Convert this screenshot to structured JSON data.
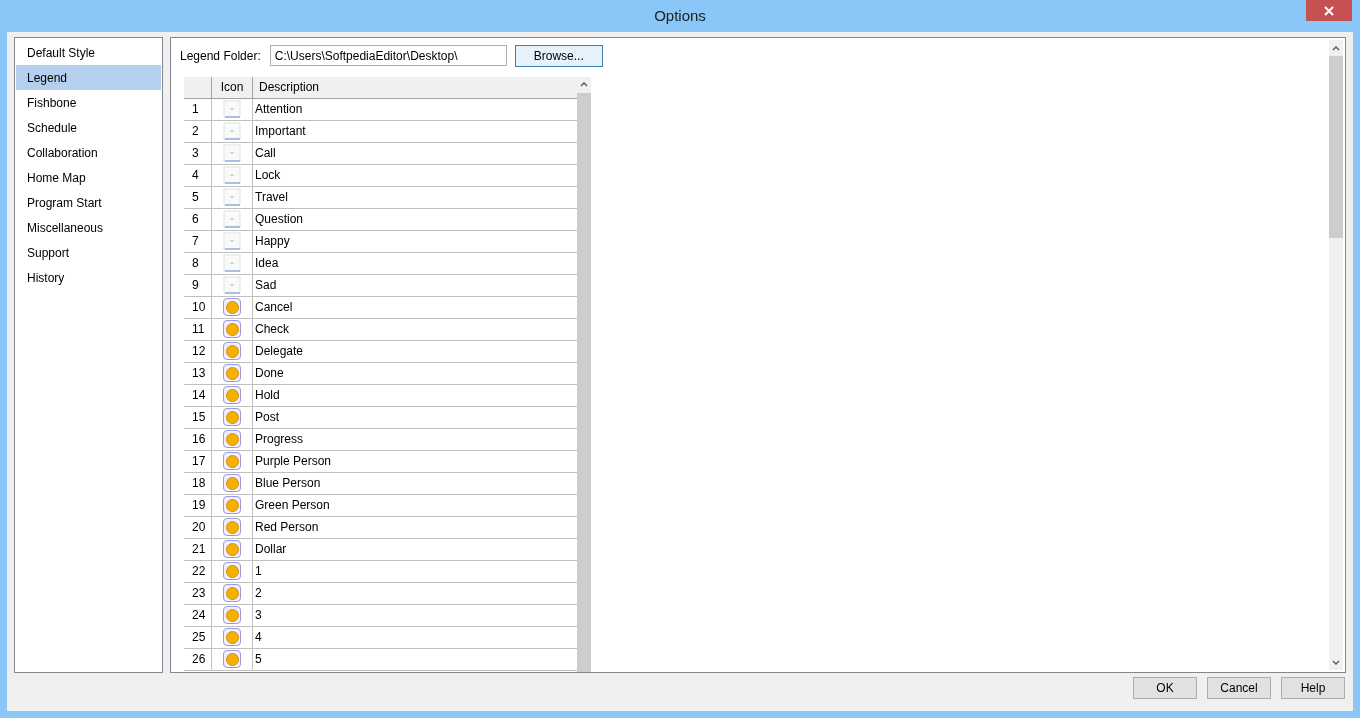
{
  "window": {
    "title": "Options"
  },
  "sidebar": {
    "items": [
      {
        "label": "Default Style",
        "selected": false
      },
      {
        "label": "Legend",
        "selected": true
      },
      {
        "label": "Fishbone",
        "selected": false
      },
      {
        "label": "Schedule",
        "selected": false
      },
      {
        "label": "Collaboration",
        "selected": false
      },
      {
        "label": "Home Map",
        "selected": false
      },
      {
        "label": "Program Start",
        "selected": false
      },
      {
        "label": "Miscellaneous",
        "selected": false
      },
      {
        "label": "Support",
        "selected": false
      },
      {
        "label": "History",
        "selected": false
      }
    ]
  },
  "legend_folder": {
    "label": "Legend Folder:",
    "value": "C:\\Users\\SoftpediaEditor\\Desktop\\",
    "browse": "Browse..."
  },
  "table": {
    "columns": [
      "Icon",
      "Description"
    ],
    "rows": [
      {
        "index": "1",
        "kind": "placeholder",
        "description": "Attention"
      },
      {
        "index": "2",
        "kind": "placeholder",
        "description": "Important"
      },
      {
        "index": "3",
        "kind": "placeholder",
        "description": "Call"
      },
      {
        "index": "4",
        "kind": "placeholder",
        "description": "Lock"
      },
      {
        "index": "5",
        "kind": "placeholder",
        "description": "Travel"
      },
      {
        "index": "6",
        "kind": "placeholder",
        "description": "Question"
      },
      {
        "index": "7",
        "kind": "placeholder",
        "description": "Happy"
      },
      {
        "index": "8",
        "kind": "placeholder",
        "description": "Idea"
      },
      {
        "index": "9",
        "kind": "placeholder",
        "description": "Sad"
      },
      {
        "index": "10",
        "kind": "numbered",
        "description": "Cancel"
      },
      {
        "index": "11",
        "kind": "numbered",
        "description": "Check"
      },
      {
        "index": "12",
        "kind": "numbered",
        "description": "Delegate"
      },
      {
        "index": "13",
        "kind": "numbered",
        "description": "Done"
      },
      {
        "index": "14",
        "kind": "numbered",
        "description": "Hold"
      },
      {
        "index": "15",
        "kind": "numbered",
        "description": "Post"
      },
      {
        "index": "16",
        "kind": "numbered",
        "description": "Progress"
      },
      {
        "index": "17",
        "kind": "numbered",
        "description": "Purple Person"
      },
      {
        "index": "18",
        "kind": "numbered",
        "description": "Blue Person"
      },
      {
        "index": "19",
        "kind": "numbered",
        "description": "Green Person"
      },
      {
        "index": "20",
        "kind": "numbered",
        "description": "Red Person"
      },
      {
        "index": "21",
        "kind": "numbered",
        "description": "Dollar"
      },
      {
        "index": "22",
        "kind": "numbered",
        "description": "1"
      },
      {
        "index": "23",
        "kind": "numbered",
        "description": "2"
      },
      {
        "index": "24",
        "kind": "numbered",
        "description": "3"
      },
      {
        "index": "25",
        "kind": "numbered",
        "description": "4"
      },
      {
        "index": "26",
        "kind": "numbered",
        "description": "5"
      }
    ]
  },
  "buttons": [
    "OK",
    "Cancel",
    "Help"
  ]
}
